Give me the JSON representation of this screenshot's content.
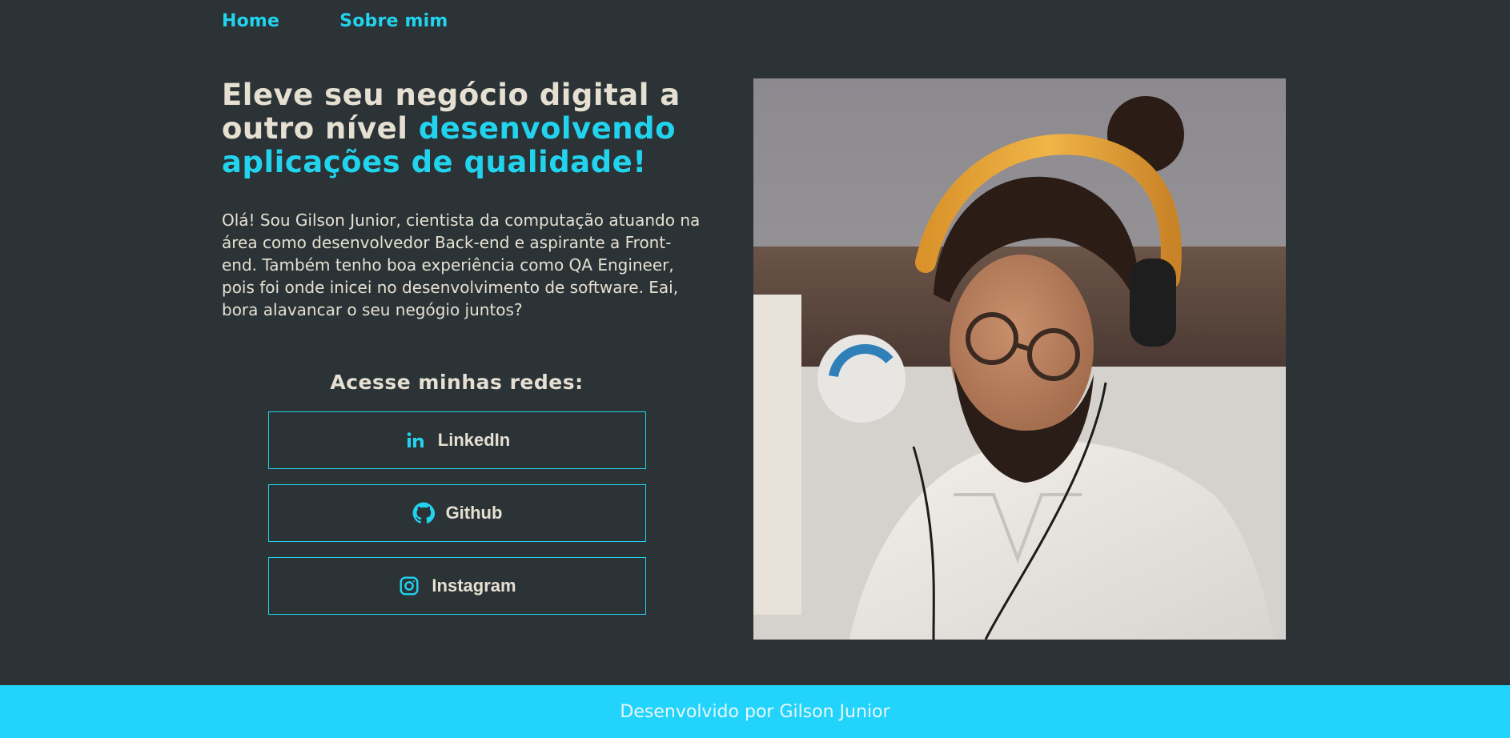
{
  "nav": {
    "items": [
      {
        "label": "Home"
      },
      {
        "label": "Sobre mim"
      }
    ]
  },
  "hero": {
    "headline_part1": "Eleve seu negócio digital a outro nível ",
    "headline_highlight": "desenvolvendo aplicações de qualidade!",
    "intro": "Olá! Sou Gilson Junior, cientista da computação atuando na área como desenvolvedor Back-end e aspirante a Front-end. Também tenho boa experiência como QA Engineer, pois foi onde inicei no desenvolvimento de software. Eai, bora alavancar o seu negógio juntos?"
  },
  "socials": {
    "title": "Acesse minhas redes:",
    "buttons": [
      {
        "label": "LinkedIn",
        "icon": "linkedin-icon"
      },
      {
        "label": "Github",
        "icon": "github-icon"
      },
      {
        "label": "Instagram",
        "icon": "instagram-icon"
      }
    ]
  },
  "footer": {
    "text": "Desenvolvido por Gilson Junior"
  },
  "colors": {
    "background": "#2b3336",
    "accent": "#22d3ee",
    "text": "#e6e0d2",
    "footer_bg": "#22d3fc"
  }
}
